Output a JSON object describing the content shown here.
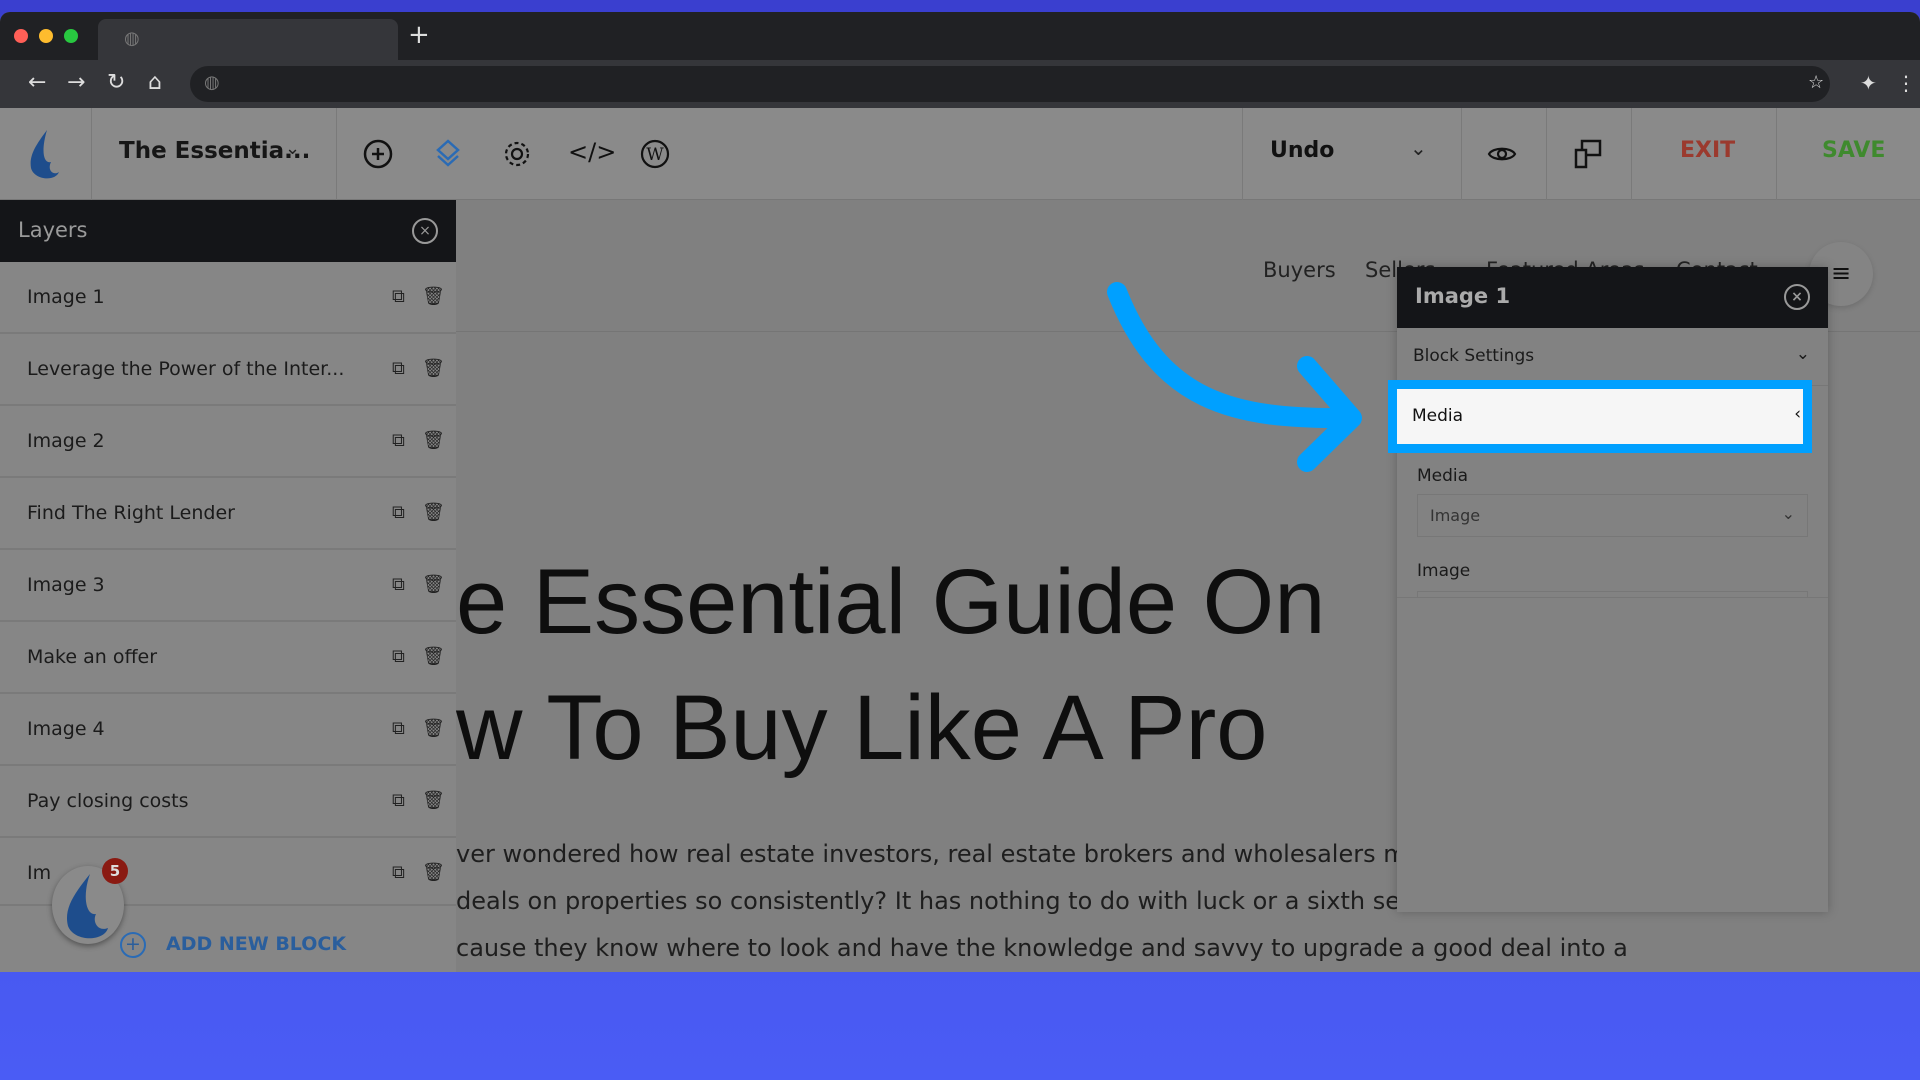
{
  "app": {
    "title": "The Essentia...",
    "undo_label": "Undo",
    "exit_label": "EXIT",
    "save_label": "SAVE",
    "exit_color": "#9b3a2e",
    "save_color": "#3f8a2e",
    "accent": "#2a6bb5"
  },
  "layers": {
    "title": "Layers",
    "items": [
      "Image 1",
      "Leverage the Power of the Inter...",
      "Image 2",
      "Find The Right Lender",
      "Image 3",
      "Make an offer",
      "Image 4",
      "Pay closing costs",
      "Im"
    ],
    "add_label": "ADD NEW BLOCK",
    "badge": "5"
  },
  "nav": {
    "items": [
      "Buyers",
      "Sellers",
      "Featured Areas",
      "Contact"
    ]
  },
  "page": {
    "heading1": "e Essential Guide On",
    "heading2": "w To Buy Like A Pro",
    "body": [
      "ver wondered how real estate investors, real estate brokers and wholesalers man",
      "deals on properties so consistently? It has nothing to do with luck or a sixth sens",
      "cause they know where to look and have the knowledge and savvy to upgrade a good deal into a"
    ]
  },
  "panel": {
    "title": "Image 1",
    "block_settings": "Block Settings",
    "media_section": "Media",
    "media_label": "Media",
    "media_value": "Image",
    "image_label": "Image",
    "highlight_color": "#00a0ff"
  }
}
